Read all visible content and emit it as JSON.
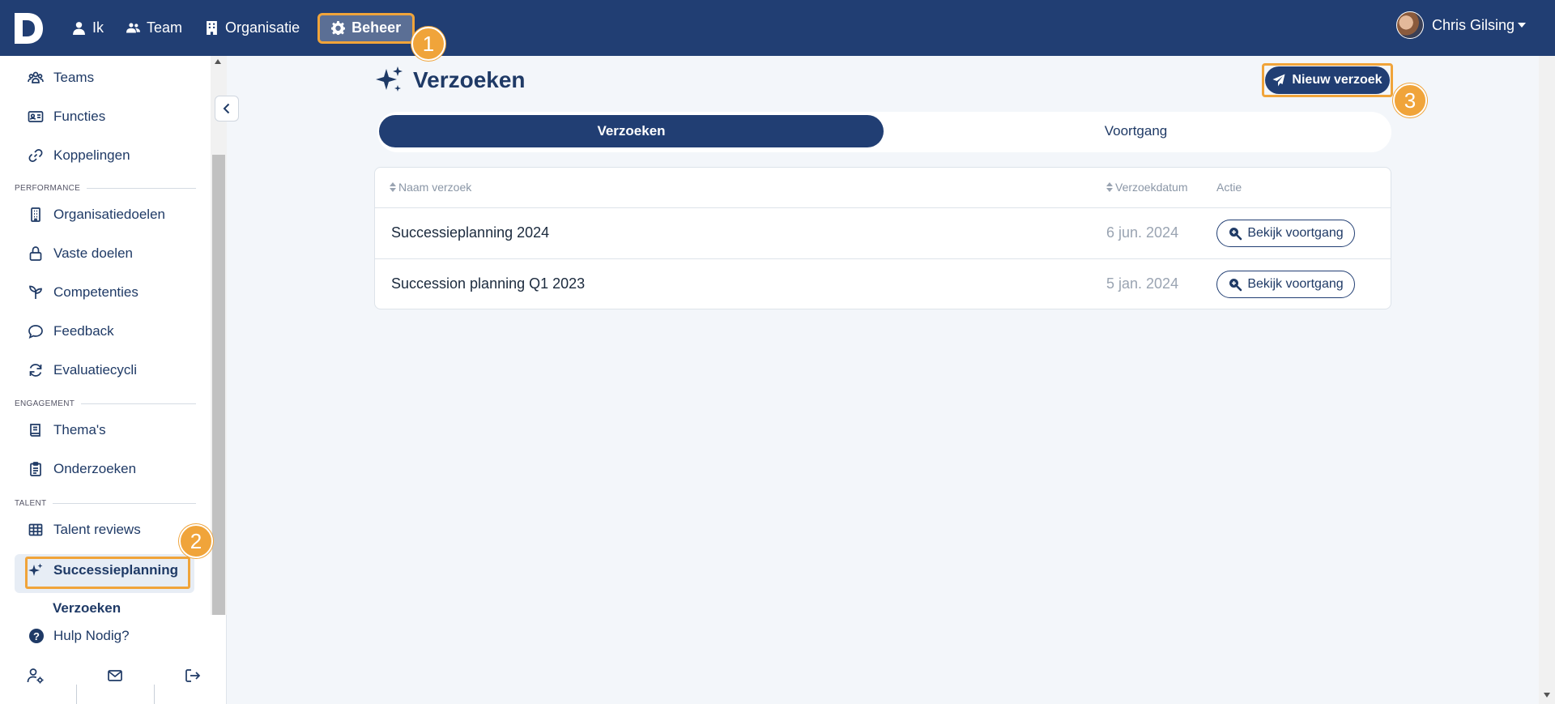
{
  "topbar": {
    "nav": [
      {
        "label": "Ik",
        "icon": "user-icon"
      },
      {
        "label": "Team",
        "icon": "users-icon"
      },
      {
        "label": "Organisatie",
        "icon": "building-icon"
      },
      {
        "label": "Beheer",
        "icon": "gear-icon",
        "active": true
      }
    ],
    "user_name": "Chris Gilsing"
  },
  "annotations": [
    "1",
    "2",
    "3"
  ],
  "sidebar": {
    "items_top": [
      {
        "label": "Teams",
        "icon": "teams-icon"
      },
      {
        "label": "Functies",
        "icon": "id-card-icon"
      },
      {
        "label": "Koppelingen",
        "icon": "link-icon"
      }
    ],
    "section_performance": "PERFORMANCE",
    "items_performance": [
      {
        "label": "Organisatiedoelen",
        "icon": "building-icon"
      },
      {
        "label": "Vaste doelen",
        "icon": "lock-icon"
      },
      {
        "label": "Competenties",
        "icon": "sprout-icon"
      },
      {
        "label": "Feedback",
        "icon": "chat-bubble-icon"
      },
      {
        "label": "Evaluatiecycli",
        "icon": "refresh-icon"
      }
    ],
    "section_engagement": "ENGAGEMENT",
    "items_engagement": [
      {
        "label": "Thema's",
        "icon": "book-icon"
      },
      {
        "label": "Onderzoeken",
        "icon": "clipboard-icon"
      }
    ],
    "section_talent": "TALENT",
    "items_talent": [
      {
        "label": "Talent reviews",
        "icon": "grid-icon"
      },
      {
        "label": "Successieplanning",
        "icon": "sparkles-icon",
        "active": true
      }
    ],
    "sub_active": "Verzoeken",
    "help": "Hulp Nodig?"
  },
  "main": {
    "title": "Verzoeken",
    "new_button": "Nieuw verzoek",
    "tabs": [
      {
        "label": "Verzoeken",
        "active": true
      },
      {
        "label": "Voortgang",
        "active": false
      }
    ],
    "table": {
      "headers": {
        "name": "Naam verzoek",
        "date": "Verzoekdatum",
        "action": "Actie"
      },
      "rows": [
        {
          "name": "Successieplanning 2024",
          "date": "6 jun. 2024",
          "action": "Bekijk voortgang"
        },
        {
          "name": "Succession planning Q1 2023",
          "date": "5 jan. 2024",
          "action": "Bekijk voortgang"
        }
      ]
    }
  },
  "colors": {
    "primary": "#213e73",
    "highlight": "#f0a43a",
    "background": "#f3f6fa"
  }
}
